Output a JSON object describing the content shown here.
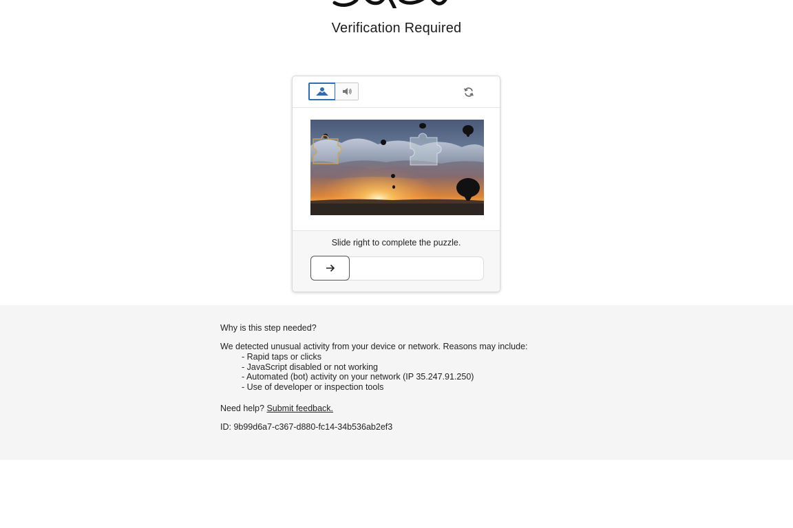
{
  "page": {
    "title": "Verification Required"
  },
  "captcha": {
    "modes": [
      {
        "name": "image",
        "icon": "image-icon",
        "selected": true
      },
      {
        "name": "audio",
        "icon": "speaker-icon",
        "selected": false
      }
    ],
    "refresh_icon": "refresh-icon",
    "instruction": "Slide right to complete the puzzle.",
    "slider_icon": "arrow-right-icon",
    "slider_progress": 0
  },
  "info": {
    "why_heading": "Why is this step needed?",
    "reasons_intro": "We detected unusual activity from your device or network. Reasons may include:",
    "reasons": [
      "- Rapid taps or clicks",
      "- JavaScript disabled or not working",
      "- Automated (bot) activity on your network (IP 35.247.91.250)",
      "- Use of developer or inspection tools"
    ],
    "help_prefix": "Need help?",
    "feedback_link": "Submit feedback.",
    "id_line": "ID: 9b99d6a7-c367-d880-fc14-34b536ab2ef3"
  },
  "colors": {
    "accent": "#2f6db3",
    "info_background": "#f5f5f5",
    "text": "#222222"
  }
}
